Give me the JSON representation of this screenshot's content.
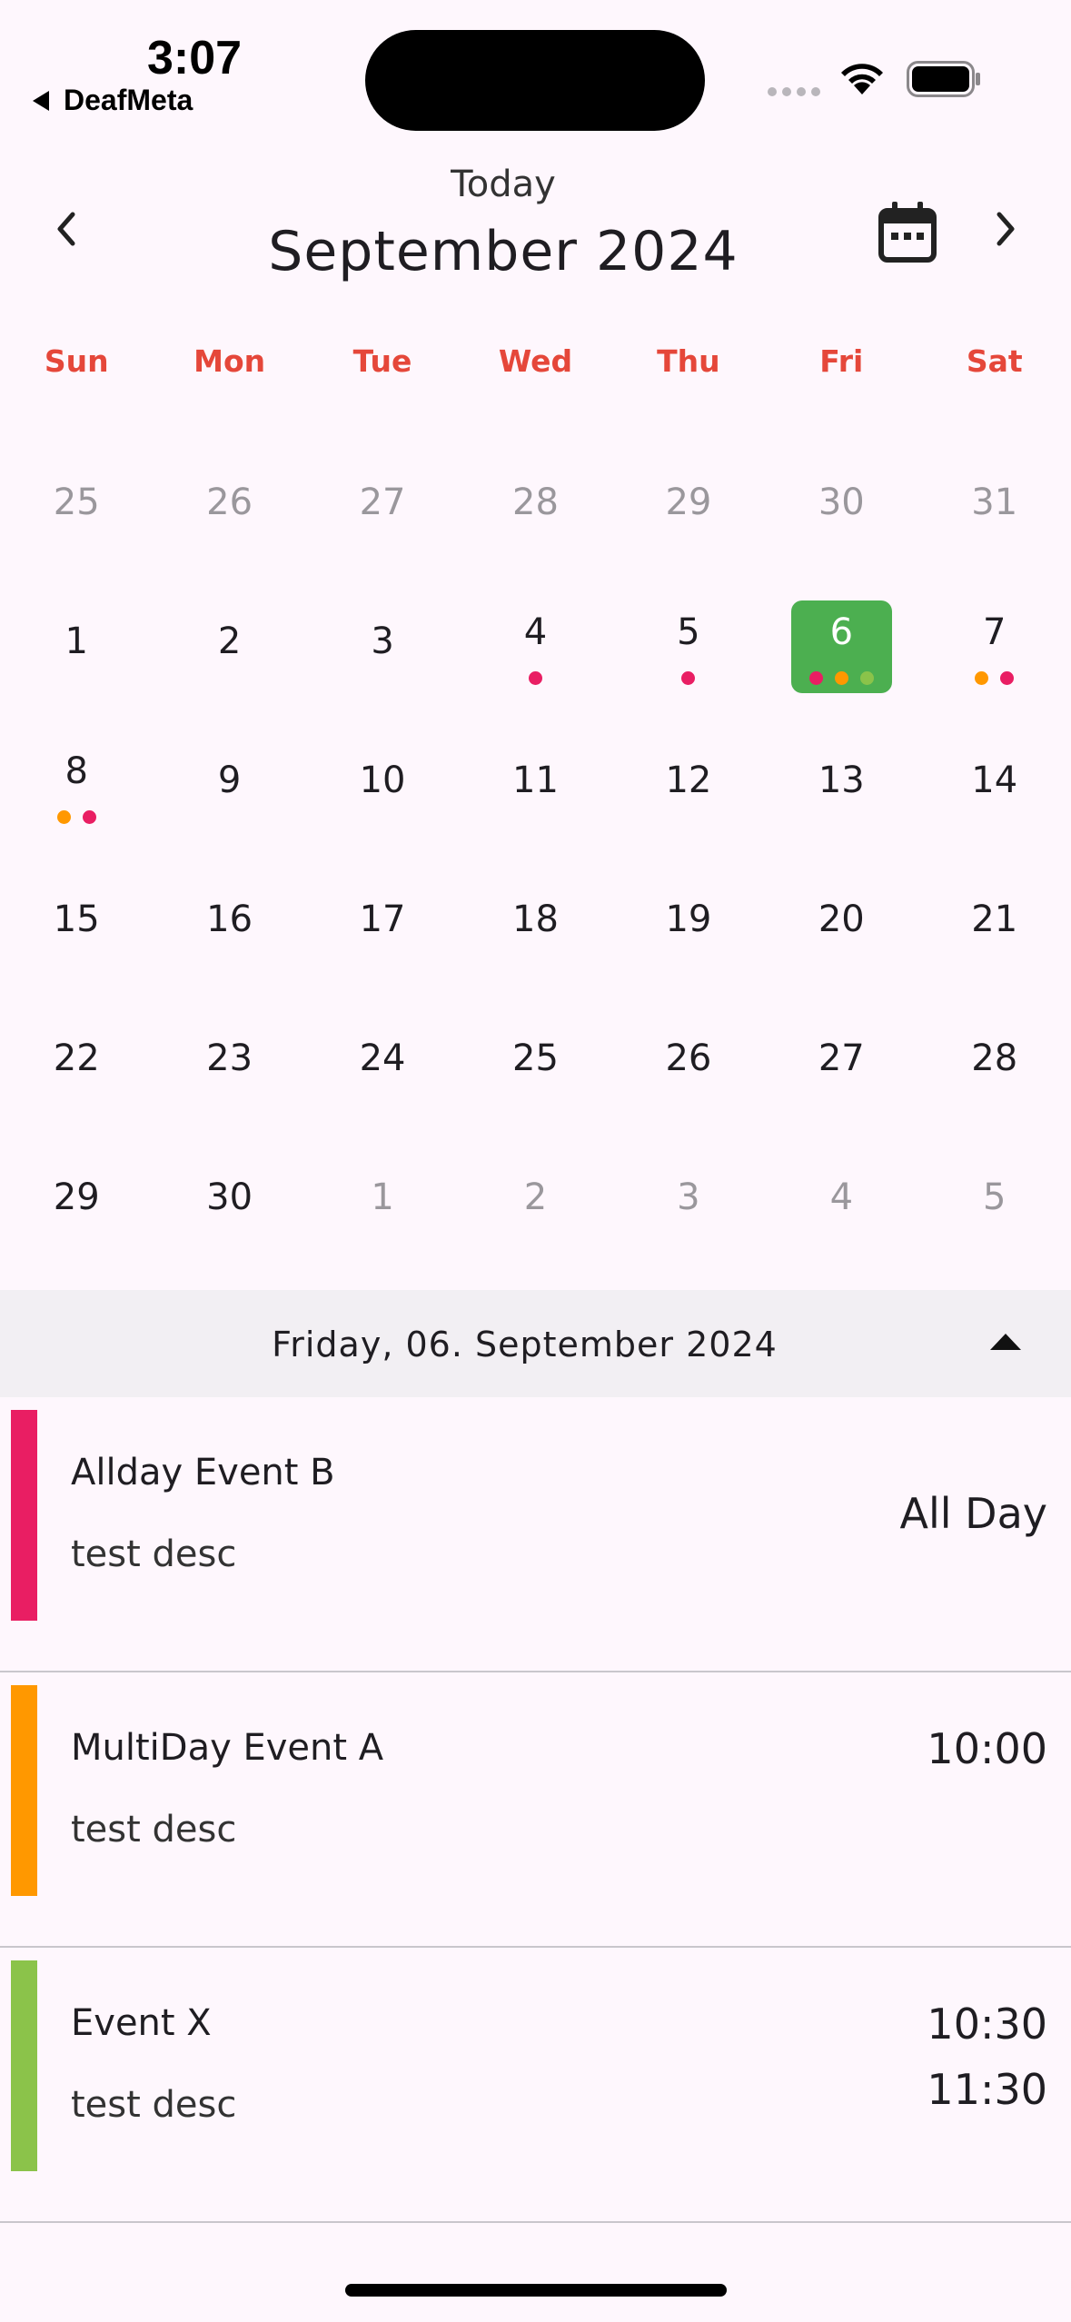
{
  "status_bar": {
    "time": "3:07",
    "back_app": "DeafMeta"
  },
  "header": {
    "today_label": "Today",
    "month_title": "September 2024"
  },
  "weekdays": [
    "Sun",
    "Mon",
    "Tue",
    "Wed",
    "Thu",
    "Fri",
    "Sat"
  ],
  "calendar": {
    "weeks": [
      [
        {
          "day": "25",
          "muted": true,
          "dots": []
        },
        {
          "day": "26",
          "muted": true,
          "dots": []
        },
        {
          "day": "27",
          "muted": true,
          "dots": []
        },
        {
          "day": "28",
          "muted": true,
          "dots": []
        },
        {
          "day": "29",
          "muted": true,
          "dots": []
        },
        {
          "day": "30",
          "muted": true,
          "dots": []
        },
        {
          "day": "31",
          "muted": true,
          "dots": []
        }
      ],
      [
        {
          "day": "1",
          "muted": false,
          "dots": []
        },
        {
          "day": "2",
          "muted": false,
          "dots": []
        },
        {
          "day": "3",
          "muted": false,
          "dots": []
        },
        {
          "day": "4",
          "muted": false,
          "dots": [
            "#e91e63"
          ]
        },
        {
          "day": "5",
          "muted": false,
          "dots": [
            "#e91e63"
          ]
        },
        {
          "day": "6",
          "muted": false,
          "selected": true,
          "dots": [
            "#e91e63",
            "#ff9800",
            "#8bc34a"
          ]
        },
        {
          "day": "7",
          "muted": false,
          "dots": [
            "#ff9800",
            "#e91e63"
          ]
        }
      ],
      [
        {
          "day": "8",
          "muted": false,
          "dots": [
            "#ff9800",
            "#e91e63"
          ]
        },
        {
          "day": "9",
          "muted": false,
          "dots": []
        },
        {
          "day": "10",
          "muted": false,
          "dots": []
        },
        {
          "day": "11",
          "muted": false,
          "dots": []
        },
        {
          "day": "12",
          "muted": false,
          "dots": []
        },
        {
          "day": "13",
          "muted": false,
          "dots": []
        },
        {
          "day": "14",
          "muted": false,
          "dots": []
        }
      ],
      [
        {
          "day": "15",
          "muted": false,
          "dots": []
        },
        {
          "day": "16",
          "muted": false,
          "dots": []
        },
        {
          "day": "17",
          "muted": false,
          "dots": []
        },
        {
          "day": "18",
          "muted": false,
          "dots": []
        },
        {
          "day": "19",
          "muted": false,
          "dots": []
        },
        {
          "day": "20",
          "muted": false,
          "dots": []
        },
        {
          "day": "21",
          "muted": false,
          "dots": []
        }
      ],
      [
        {
          "day": "22",
          "muted": false,
          "dots": []
        },
        {
          "day": "23",
          "muted": false,
          "dots": []
        },
        {
          "day": "24",
          "muted": false,
          "dots": []
        },
        {
          "day": "25",
          "muted": false,
          "dots": []
        },
        {
          "day": "26",
          "muted": false,
          "dots": []
        },
        {
          "day": "27",
          "muted": false,
          "dots": []
        },
        {
          "day": "28",
          "muted": false,
          "dots": []
        }
      ],
      [
        {
          "day": "29",
          "muted": false,
          "dots": []
        },
        {
          "day": "30",
          "muted": false,
          "dots": []
        },
        {
          "day": "1",
          "muted": true,
          "dots": []
        },
        {
          "day": "2",
          "muted": true,
          "dots": []
        },
        {
          "day": "3",
          "muted": true,
          "dots": []
        },
        {
          "day": "4",
          "muted": true,
          "dots": []
        },
        {
          "day": "5",
          "muted": true,
          "dots": []
        }
      ]
    ],
    "selected_color": "#4caf50",
    "weekday_color": "#e5473a"
  },
  "selected_date": {
    "label": "Friday, 06. September 2024"
  },
  "events": [
    {
      "title": "Allday Event B",
      "desc": "test desc",
      "time_lines": [
        "All Day"
      ],
      "color": "#e91e63"
    },
    {
      "title": "MultiDay Event A",
      "desc": "test desc",
      "time_lines": [
        "10:00"
      ],
      "color": "#ff9800"
    },
    {
      "title": "Event X",
      "desc": "test desc",
      "time_lines": [
        "10:30",
        "11:30"
      ],
      "color": "#8bc34a"
    }
  ]
}
